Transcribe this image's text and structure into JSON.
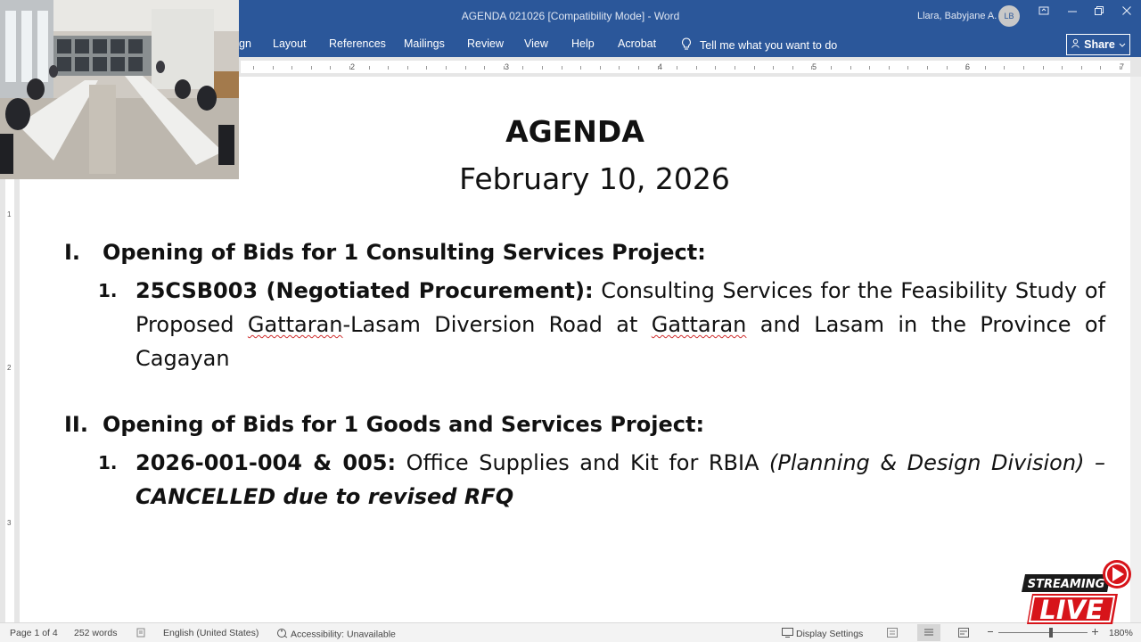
{
  "window": {
    "title": "AGENDA 021026 [Compatibility Mode]  -  Word",
    "user": "Llara, Babyjane A.",
    "avatar_initials": "LB"
  },
  "ribbon": {
    "tabs": [
      "gn",
      "Layout",
      "References",
      "Mailings",
      "Review",
      "View",
      "Help",
      "Acrobat"
    ],
    "tell_me": "Tell me what you want to do",
    "share": "Share"
  },
  "ruler": {
    "h_numbers": [
      "2",
      "3",
      "4",
      "5",
      "6",
      "7"
    ],
    "v_numbers": [
      "1",
      "2",
      "3"
    ]
  },
  "document": {
    "title": "AGENDA",
    "date": "February 10, 2026",
    "sections": [
      {
        "numeral": "I.",
        "title": "Opening of Bids for 1 Consulting Services Project:",
        "items": [
          {
            "num": "1.",
            "code": "25CSB003 (Negotiated Procurement):",
            "desc_1": " Consulting Services for the Feasibility Study of Proposed ",
            "desc_2": "Gattaran",
            "desc_3": "-Lasam Diversion Road at ",
            "desc_4": "Gattaran",
            "desc_5": " and Lasam in the Province of Cagayan"
          }
        ]
      },
      {
        "numeral": "II.",
        "title": "Opening of Bids for 1 Goods and Services Project:",
        "items": [
          {
            "num": "1.",
            "code": "2026-001-004 & 005:",
            "desc": " Office Supplies and Kit for RBIA ",
            "division": "(Planning & Design Division)",
            "dash": " –",
            "status": "CANCELLED due to revised RFQ"
          }
        ]
      }
    ]
  },
  "statusbar": {
    "page": "Page 1 of 4",
    "words": "252 words",
    "language": "English (United States)",
    "accessibility": "Accessibility: Unavailable",
    "display_settings": "Display Settings",
    "zoom": "180%"
  },
  "overlay": {
    "streaming_text": "STREAMING",
    "live_text": "LIVE",
    "colors": {
      "live_red": "#d7141a",
      "word_blue": "#2b579a"
    }
  }
}
